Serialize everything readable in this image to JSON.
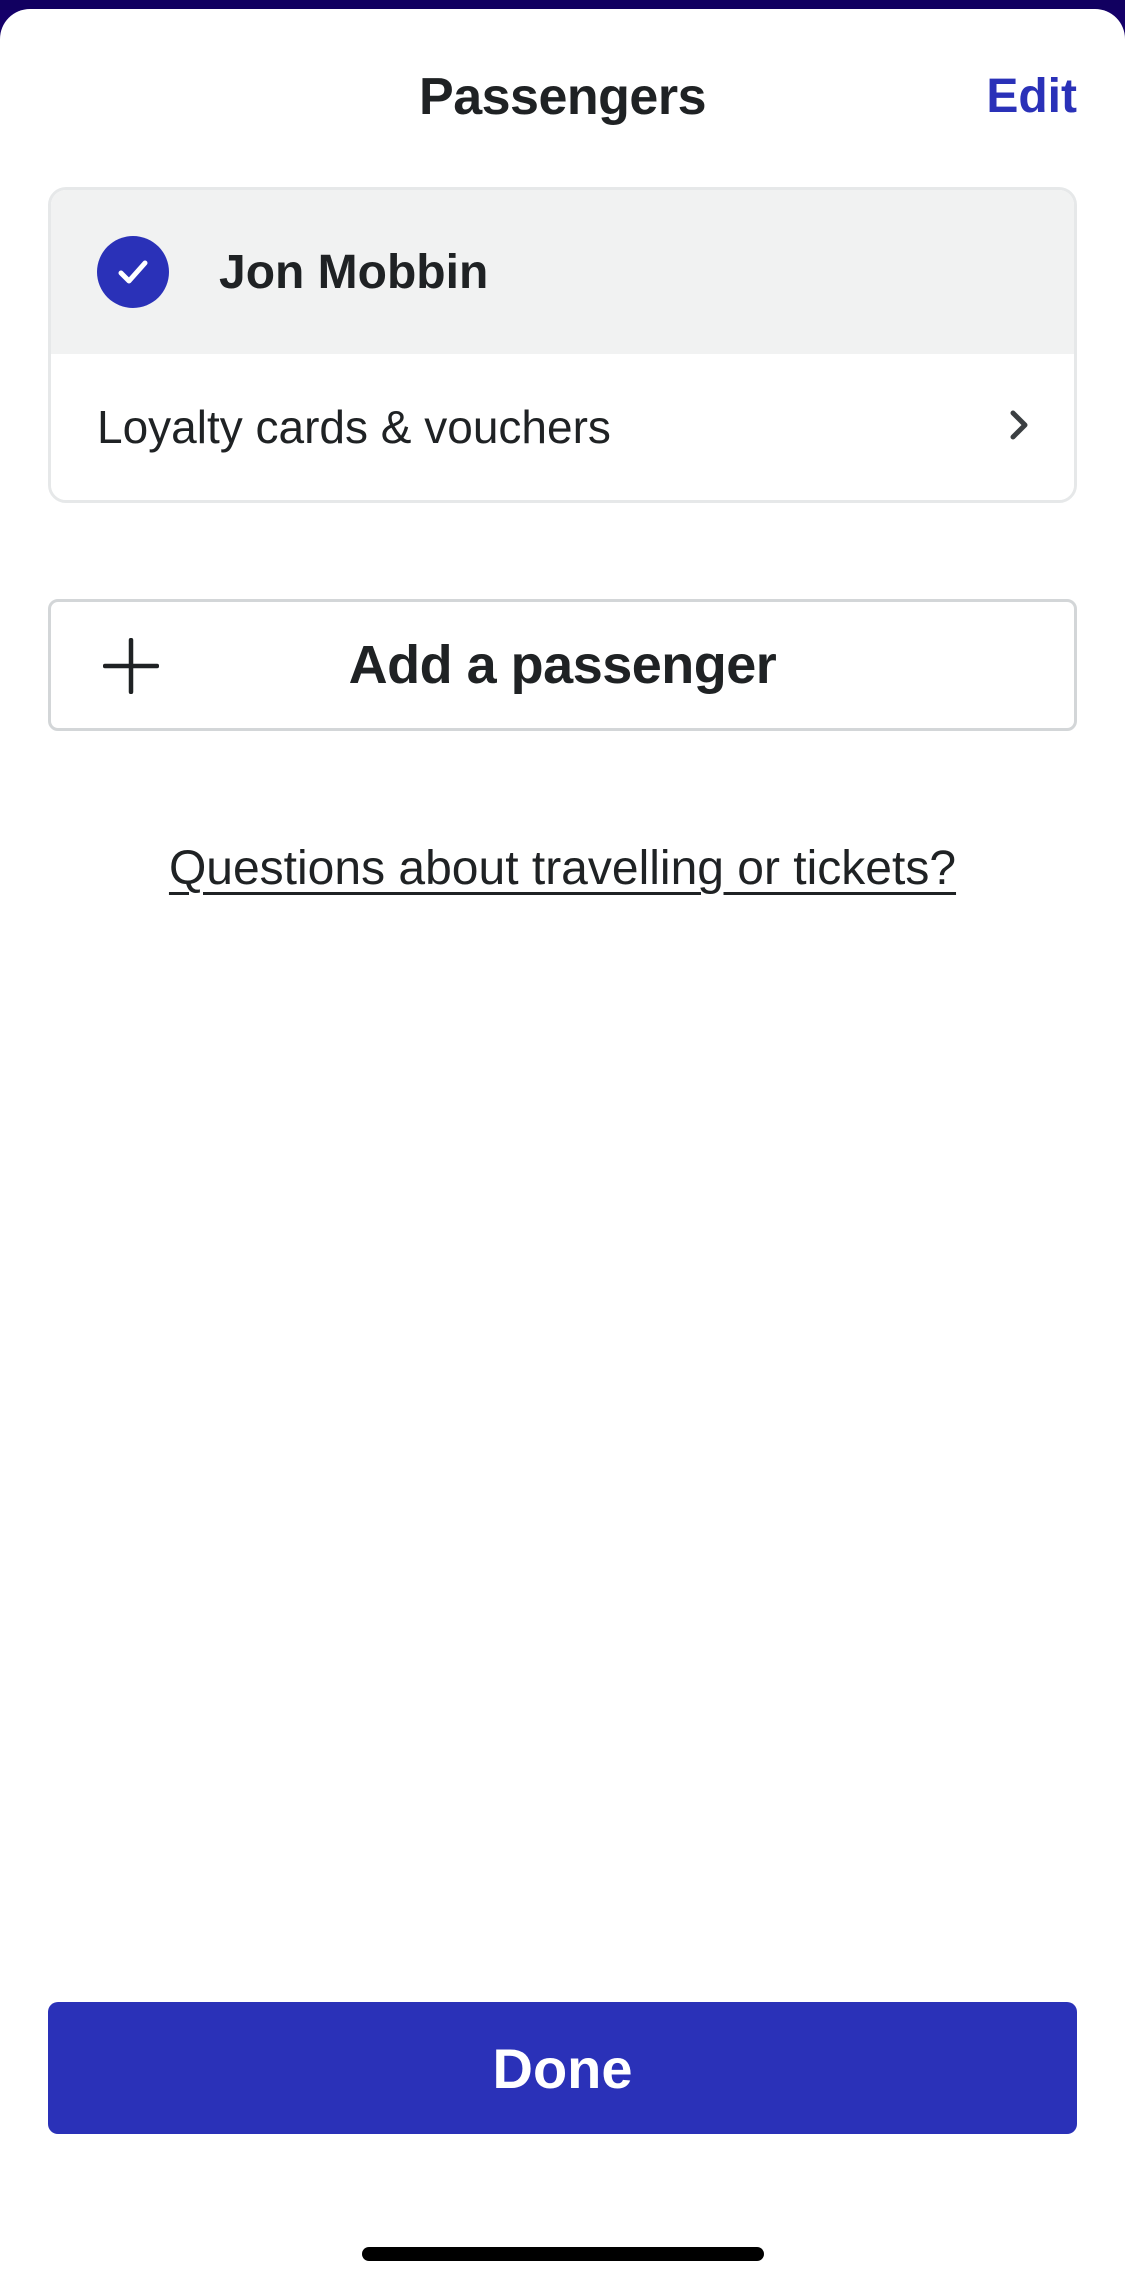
{
  "header": {
    "title": "Passengers",
    "edit_label": "Edit"
  },
  "passengers": [
    {
      "name": "Jon Mobbin",
      "selected": true,
      "loyalty_label": "Loyalty cards & vouchers"
    }
  ],
  "add_passenger_label": "Add a passenger",
  "questions_link": "Questions about travelling or tickets?",
  "done_label": "Done",
  "colors": {
    "accent": "#2a31b8",
    "selected_row_bg": "#f1f2f2",
    "text": "#1f2224"
  },
  "icons": {
    "check": "check-icon",
    "chevron": "chevron-right-icon",
    "plus": "plus-icon"
  }
}
